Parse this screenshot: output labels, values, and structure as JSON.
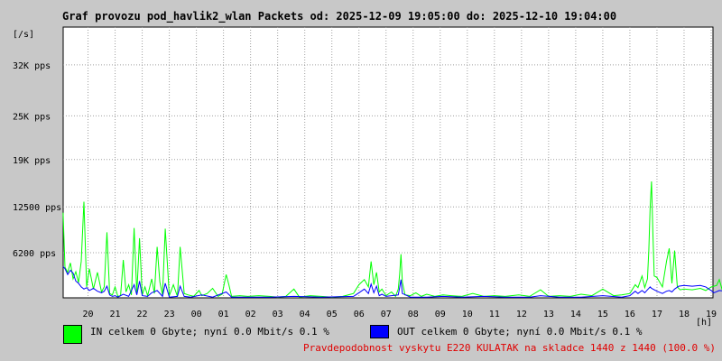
{
  "title": "Graf provozu pod_havlik2_wlan Packets od: 2025-12-09 19:05:00 do: 2025-12-10 19:04:00",
  "chart_data": {
    "type": "line",
    "ylabel": "[/s]",
    "xlabel": "[h]",
    "ylim": [
      0,
      37200
    ],
    "yticks": [
      {
        "value": 6200,
        "label": "6200 pps"
      },
      {
        "value": 12500,
        "label": "12500 pps"
      },
      {
        "value": 19000,
        "label": "19K pps"
      },
      {
        "value": 25000,
        "label": "25K pps"
      },
      {
        "value": 32000,
        "label": "32K pps"
      }
    ],
    "x_start_hour": 19.083,
    "x_end_hour": 43.067,
    "xticks": [
      "20",
      "21",
      "22",
      "23",
      "00",
      "01",
      "02",
      "03",
      "04",
      "05",
      "06",
      "07",
      "08",
      "09",
      "10",
      "11",
      "12",
      "13",
      "14",
      "15",
      "16",
      "17",
      "18",
      "19"
    ],
    "grid": true,
    "series": [
      {
        "name": "IN",
        "color": "#00ff00",
        "points": [
          [
            19.08,
            11700
          ],
          [
            19.15,
            4200
          ],
          [
            19.25,
            3500
          ],
          [
            19.35,
            4800
          ],
          [
            19.45,
            2600
          ],
          [
            19.55,
            3600
          ],
          [
            19.65,
            2100
          ],
          [
            19.75,
            5000
          ],
          [
            19.85,
            13200
          ],
          [
            19.95,
            1500
          ],
          [
            20.05,
            4000
          ],
          [
            20.2,
            1200
          ],
          [
            20.35,
            3500
          ],
          [
            20.5,
            800
          ],
          [
            20.6,
            1500
          ],
          [
            20.7,
            9000
          ],
          [
            20.8,
            600
          ],
          [
            20.9,
            400
          ],
          [
            21.0,
            1500
          ],
          [
            21.1,
            200
          ],
          [
            21.2,
            300
          ],
          [
            21.3,
            5200
          ],
          [
            21.4,
            800
          ],
          [
            21.5,
            1800
          ],
          [
            21.6,
            400
          ],
          [
            21.7,
            9600
          ],
          [
            21.8,
            600
          ],
          [
            21.9,
            8200
          ],
          [
            22.0,
            400
          ],
          [
            22.1,
            1500
          ],
          [
            22.2,
            300
          ],
          [
            22.35,
            2600
          ],
          [
            22.45,
            600
          ],
          [
            22.55,
            7000
          ],
          [
            22.65,
            2200
          ],
          [
            22.75,
            400
          ],
          [
            22.85,
            9500
          ],
          [
            23.0,
            300
          ],
          [
            23.15,
            1800
          ],
          [
            23.3,
            200
          ],
          [
            23.4,
            7000
          ],
          [
            23.55,
            600
          ],
          [
            23.7,
            400
          ],
          [
            23.9,
            200
          ],
          [
            24.1,
            1000
          ],
          [
            24.2,
            300
          ],
          [
            24.4,
            600
          ],
          [
            24.6,
            1300
          ],
          [
            24.8,
            200
          ],
          [
            24.95,
            500
          ],
          [
            25.1,
            3200
          ],
          [
            25.2,
            1800
          ],
          [
            25.3,
            200
          ],
          [
            25.6,
            300
          ],
          [
            25.9,
            200
          ],
          [
            26.3,
            300
          ],
          [
            26.7,
            200
          ],
          [
            27.0,
            100
          ],
          [
            27.3,
            200
          ],
          [
            27.6,
            1200
          ],
          [
            27.8,
            100
          ],
          [
            28.2,
            300
          ],
          [
            28.6,
            200
          ],
          [
            29.0,
            100
          ],
          [
            29.4,
            200
          ],
          [
            29.8,
            600
          ],
          [
            30.0,
            1800
          ],
          [
            30.2,
            2500
          ],
          [
            30.35,
            1500
          ],
          [
            30.45,
            5000
          ],
          [
            30.55,
            1800
          ],
          [
            30.65,
            3500
          ],
          [
            30.75,
            800
          ],
          [
            30.85,
            1200
          ],
          [
            31.0,
            300
          ],
          [
            31.2,
            800
          ],
          [
            31.35,
            200
          ],
          [
            31.45,
            1200
          ],
          [
            31.5,
            3200
          ],
          [
            31.55,
            6000
          ],
          [
            31.6,
            2200
          ],
          [
            31.7,
            400
          ],
          [
            31.9,
            300
          ],
          [
            32.1,
            700
          ],
          [
            32.3,
            200
          ],
          [
            32.5,
            500
          ],
          [
            32.8,
            200
          ],
          [
            33.1,
            400
          ],
          [
            33.4,
            300
          ],
          [
            33.8,
            200
          ],
          [
            34.2,
            600
          ],
          [
            34.6,
            200
          ],
          [
            35.0,
            300
          ],
          [
            35.4,
            200
          ],
          [
            35.9,
            400
          ],
          [
            36.3,
            200
          ],
          [
            36.7,
            1100
          ],
          [
            37.0,
            200
          ],
          [
            37.4,
            300
          ],
          [
            37.8,
            200
          ],
          [
            38.2,
            500
          ],
          [
            38.6,
            300
          ],
          [
            39.0,
            1200
          ],
          [
            39.4,
            300
          ],
          [
            39.7,
            400
          ],
          [
            40.0,
            600
          ],
          [
            40.2,
            1800
          ],
          [
            40.3,
            1400
          ],
          [
            40.45,
            3000
          ],
          [
            40.55,
            1400
          ],
          [
            40.65,
            2600
          ],
          [
            40.7,
            6500
          ],
          [
            40.75,
            12500
          ],
          [
            40.8,
            16000
          ],
          [
            40.85,
            9000
          ],
          [
            40.9,
            3000
          ],
          [
            41.0,
            2800
          ],
          [
            41.2,
            1500
          ],
          [
            41.35,
            5000
          ],
          [
            41.45,
            6800
          ],
          [
            41.55,
            2000
          ],
          [
            41.65,
            6500
          ],
          [
            41.75,
            1500
          ],
          [
            41.85,
            1100
          ],
          [
            42.0,
            1200
          ],
          [
            42.3,
            1100
          ],
          [
            42.6,
            1300
          ],
          [
            42.8,
            1000
          ],
          [
            43.0,
            1500
          ],
          [
            43.1,
            1600
          ],
          [
            43.2,
            1700
          ],
          [
            43.3,
            2500
          ],
          [
            43.4,
            1200
          ],
          [
            43.5,
            2000
          ],
          [
            43.6,
            1500
          ],
          [
            43.7,
            2300
          ],
          [
            43.8,
            600
          ],
          [
            43.9,
            1800
          ],
          [
            43.98,
            1200
          ],
          [
            44.05,
            2300
          ],
          [
            44.15,
            1600
          ],
          [
            44.22,
            800
          ],
          [
            44.3,
            700
          ],
          [
            44.5,
            1400
          ],
          [
            44.6,
            3500
          ],
          [
            44.7,
            4800
          ],
          [
            44.75,
            6200
          ],
          [
            44.83,
            4200
          ]
        ]
      },
      {
        "name": "OUT",
        "color": "#0000ff",
        "points": [
          [
            19.08,
            4300
          ],
          [
            19.15,
            4000
          ],
          [
            19.25,
            3200
          ],
          [
            19.35,
            3800
          ],
          [
            19.45,
            3400
          ],
          [
            19.55,
            2300
          ],
          [
            19.65,
            2000
          ],
          [
            19.75,
            1500
          ],
          [
            19.85,
            1200
          ],
          [
            19.95,
            1400
          ],
          [
            20.05,
            1000
          ],
          [
            20.2,
            1300
          ],
          [
            20.35,
            900
          ],
          [
            20.5,
            700
          ],
          [
            20.6,
            900
          ],
          [
            20.7,
            1600
          ],
          [
            20.8,
            400
          ],
          [
            20.9,
            200
          ],
          [
            21.0,
            300
          ],
          [
            21.1,
            100
          ],
          [
            21.3,
            500
          ],
          [
            21.5,
            200
          ],
          [
            21.7,
            1800
          ],
          [
            21.8,
            400
          ],
          [
            21.9,
            2300
          ],
          [
            22.0,
            300
          ],
          [
            22.2,
            200
          ],
          [
            22.35,
            700
          ],
          [
            22.55,
            1000
          ],
          [
            22.75,
            200
          ],
          [
            22.85,
            2000
          ],
          [
            23.0,
            100
          ],
          [
            23.3,
            200
          ],
          [
            23.4,
            1600
          ],
          [
            23.55,
            200
          ],
          [
            23.8,
            100
          ],
          [
            24.2,
            400
          ],
          [
            24.6,
            100
          ],
          [
            25.1,
            800
          ],
          [
            25.3,
            100
          ],
          [
            25.9,
            100
          ],
          [
            26.7,
            100
          ],
          [
            27.6,
            200
          ],
          [
            28.6,
            100
          ],
          [
            29.8,
            200
          ],
          [
            30.0,
            700
          ],
          [
            30.2,
            1200
          ],
          [
            30.35,
            600
          ],
          [
            30.45,
            1900
          ],
          [
            30.55,
            700
          ],
          [
            30.65,
            1600
          ],
          [
            30.75,
            300
          ],
          [
            30.85,
            500
          ],
          [
            31.0,
            200
          ],
          [
            31.2,
            300
          ],
          [
            31.45,
            400
          ],
          [
            31.5,
            1400
          ],
          [
            31.55,
            2500
          ],
          [
            31.6,
            600
          ],
          [
            31.9,
            100
          ],
          [
            32.5,
            100
          ],
          [
            33.1,
            200
          ],
          [
            33.8,
            100
          ],
          [
            34.6,
            200
          ],
          [
            35.4,
            100
          ],
          [
            36.3,
            100
          ],
          [
            36.7,
            300
          ],
          [
            37.4,
            100
          ],
          [
            38.2,
            100
          ],
          [
            39.0,
            300
          ],
          [
            39.7,
            100
          ],
          [
            40.0,
            300
          ],
          [
            40.2,
            900
          ],
          [
            40.3,
            600
          ],
          [
            40.45,
            1000
          ],
          [
            40.55,
            700
          ],
          [
            40.65,
            1100
          ],
          [
            40.75,
            1500
          ],
          [
            40.8,
            1300
          ],
          [
            40.9,
            1100
          ],
          [
            41.0,
            900
          ],
          [
            41.2,
            600
          ],
          [
            41.35,
            900
          ],
          [
            41.45,
            1000
          ],
          [
            41.55,
            800
          ],
          [
            41.65,
            1200
          ],
          [
            41.8,
            1600
          ],
          [
            42.0,
            1700
          ],
          [
            42.3,
            1600
          ],
          [
            42.6,
            1700
          ],
          [
            42.8,
            1500
          ],
          [
            43.0,
            1000
          ],
          [
            43.1,
            700
          ],
          [
            43.3,
            1000
          ],
          [
            43.5,
            900
          ],
          [
            43.7,
            600
          ],
          [
            43.9,
            700
          ],
          [
            44.05,
            700
          ],
          [
            44.15,
            600
          ],
          [
            44.3,
            900
          ],
          [
            44.5,
            1400
          ],
          [
            44.6,
            2500
          ],
          [
            44.7,
            3600
          ],
          [
            44.75,
            5000
          ],
          [
            44.83,
            5900
          ]
        ]
      }
    ]
  },
  "legend": {
    "in": {
      "text": "IN celkem 0 Gbyte; nyní   0.0 Mbit/s 0.1 %",
      "color": "#00ff00"
    },
    "out": {
      "text": "OUT celkem 0 Gbyte; nyní   0.0 Mbit/s 0.1 %",
      "color": "#0000ff"
    }
  },
  "footer": "Pravdepodobnost vyskytu E220 KULATAK na skladce 1440 z 1440 (100.0 %)"
}
